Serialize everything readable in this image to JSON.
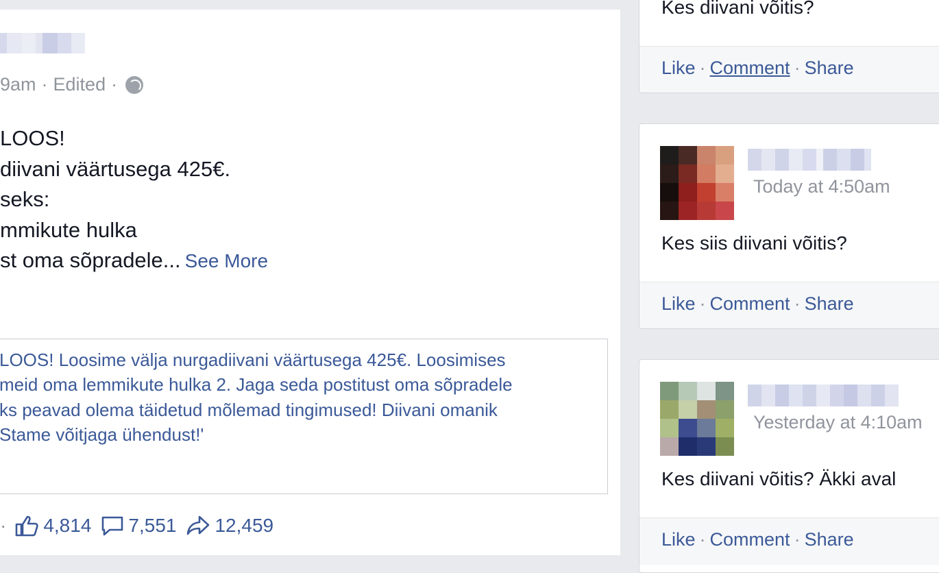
{
  "main_post": {
    "meta_time": "9am",
    "meta_sep1": "·",
    "meta_edited": "Edited",
    "meta_sep2": "·",
    "text_lines": [
      "LOOS!",
      "diivani väärtusega 425€.",
      "seks:",
      "mmikute hulka",
      "st oma sõpradele..."
    ],
    "see_more": "See More",
    "quote_lines": [
      "LOOS! Loosime välja nurgadiivani väärtusega 425€. Loosimises",
      "meid oma lemmikute hulka 2. Jaga seda postitust oma sõpradele",
      "ks peavad olema täidetud mõlemad tingimused! Diivani omanik",
      "Stame võitjaga ühendust!'"
    ],
    "stats": {
      "leading_sep": "·",
      "likes": "4,814",
      "comments": "7,551",
      "shares": "12,459"
    }
  },
  "right_cards": [
    {
      "comment": "Kes diivani võitis?",
      "actions": {
        "like": "Like",
        "comment": "Comment",
        "share": "Share",
        "sep": "·"
      }
    },
    {
      "time": "Today at 4:50am",
      "comment": "Kes siis diivani võitis?",
      "actions": {
        "like": "Like",
        "comment": "Comment",
        "share": "Share",
        "sep": "·"
      }
    },
    {
      "time": "Yesterday at 4:10am",
      "comment": "Kes diivani võitis? Äkki aval",
      "actions": {
        "like": "Like",
        "comment": "Comment",
        "share": "Share",
        "sep": "·"
      }
    }
  ],
  "colors": {
    "link": "#3b5998",
    "muted": "#90949c",
    "background": "#e9eaed"
  },
  "icons": [
    "like-thumb-icon",
    "comment-bubble-icon",
    "share-arrow-icon",
    "globe-icon"
  ]
}
